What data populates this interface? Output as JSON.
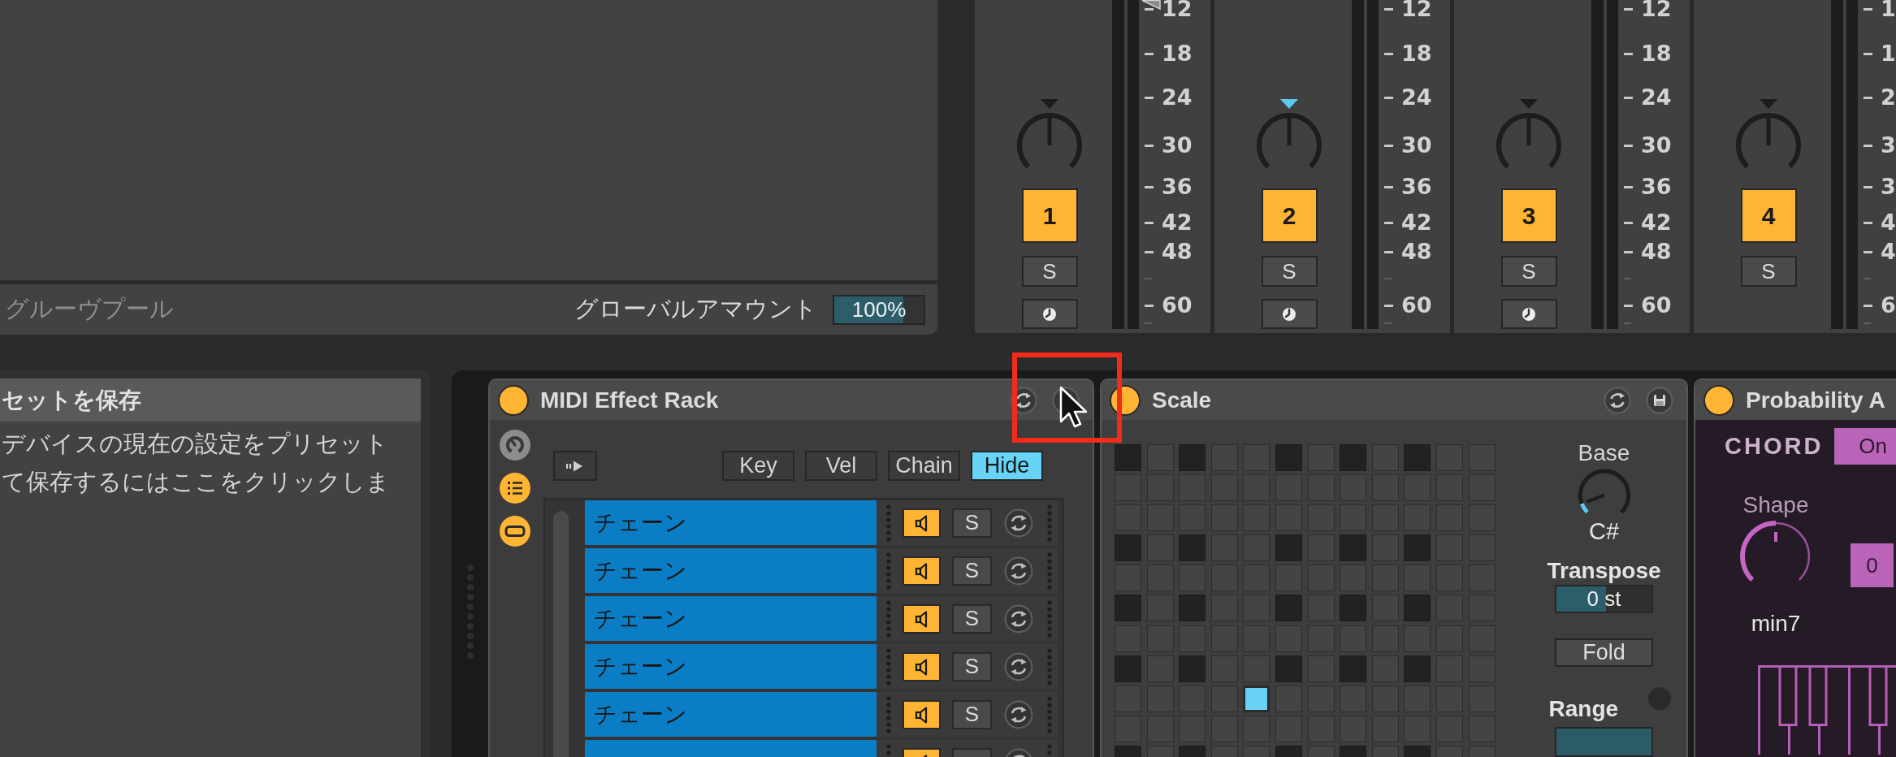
{
  "groove_pool": {
    "title": "グルーヴプール",
    "amount_label": "グローバルアマウント",
    "amount": {
      "value": "100%",
      "level": 0.77
    }
  },
  "mixer": {
    "strips": [
      {
        "number": "1",
        "active": true,
        "volume_marker": true,
        "knob": {
          "level": 0.5,
          "marker_lit": false
        },
        "buttons": [
          {
            "kind": "solo",
            "label": "S"
          },
          {
            "kind": "monitor"
          }
        ],
        "scale": [
          {
            "kind": "label",
            "label": "12"
          },
          {
            "kind": "label",
            "label": "18"
          },
          {
            "kind": "label",
            "label": "24"
          },
          {
            "kind": "label",
            "label": "30"
          },
          {
            "kind": "label",
            "label": "36"
          },
          {
            "kind": "label",
            "label": "42"
          },
          {
            "kind": "label",
            "label": "48"
          },
          {
            "kind": "minor"
          },
          {
            "kind": "label",
            "label": "60"
          },
          {
            "kind": "minor"
          }
        ]
      },
      {
        "number": "2",
        "active": true,
        "volume_marker": false,
        "knob": {
          "level": 0.5,
          "marker_lit": true
        },
        "buttons": [
          {
            "kind": "solo",
            "label": "S"
          },
          {
            "kind": "monitor"
          }
        ],
        "scale": [
          {
            "kind": "label",
            "label": "12"
          },
          {
            "kind": "label",
            "label": "18"
          },
          {
            "kind": "label",
            "label": "24"
          },
          {
            "kind": "label",
            "label": "30"
          },
          {
            "kind": "label",
            "label": "36"
          },
          {
            "kind": "label",
            "label": "42"
          },
          {
            "kind": "label",
            "label": "48"
          },
          {
            "kind": "minor"
          },
          {
            "kind": "label",
            "label": "60"
          },
          {
            "kind": "minor"
          }
        ]
      },
      {
        "number": "3",
        "active": true,
        "volume_marker": false,
        "knob": {
          "level": 0.5,
          "marker_lit": false
        },
        "buttons": [
          {
            "kind": "solo",
            "label": "S"
          },
          {
            "kind": "monitor"
          }
        ],
        "scale": [
          {
            "kind": "label",
            "label": "12"
          },
          {
            "kind": "label",
            "label": "18"
          },
          {
            "kind": "label",
            "label": "24"
          },
          {
            "kind": "label",
            "label": "30"
          },
          {
            "kind": "label",
            "label": "36"
          },
          {
            "kind": "label",
            "label": "42"
          },
          {
            "kind": "label",
            "label": "48"
          },
          {
            "kind": "minor"
          },
          {
            "kind": "label",
            "label": "60"
          },
          {
            "kind": "minor"
          }
        ]
      },
      {
        "number": "4",
        "active": true,
        "volume_marker": false,
        "knob": {
          "level": 0.5,
          "marker_lit": false
        },
        "buttons": [
          {
            "kind": "solo",
            "label": "S"
          }
        ],
        "scale": [
          {
            "kind": "label",
            "label": "1"
          },
          {
            "kind": "label",
            "label": "1"
          },
          {
            "kind": "label",
            "label": "2"
          },
          {
            "kind": "label",
            "label": "3"
          },
          {
            "kind": "label",
            "label": "3"
          },
          {
            "kind": "label",
            "label": "4"
          },
          {
            "kind": "label",
            "label": "4"
          },
          {
            "kind": "minor"
          },
          {
            "kind": "label",
            "label": "6"
          },
          {
            "kind": "minor"
          }
        ]
      }
    ]
  },
  "preset_info": {
    "title": "セットを保存",
    "lines": [
      "デバイスの現在の設定をプリセット",
      "て保存するにはここをクリックしま"
    ]
  },
  "devices": [
    {
      "kind": "rack",
      "title": "MIDI Effect Rack",
      "on": true,
      "header_icons": [
        {
          "kind": "hotswap"
        },
        {
          "kind": "save"
        }
      ],
      "side_toggles": [
        {
          "kind": "macros",
          "on": false
        },
        {
          "kind": "chains",
          "on": true
        },
        {
          "kind": "devices",
          "on": true
        }
      ],
      "view_buttons": [
        {
          "label": "Key",
          "selected": false
        },
        {
          "label": "Vel",
          "selected": false
        },
        {
          "label": "Chain",
          "selected": false
        },
        {
          "label": "Hide",
          "selected": true
        }
      ],
      "chains": [
        {
          "name": "チェーン",
          "active": true,
          "solo_label": "S",
          "soloed": false
        },
        {
          "name": "チェーン",
          "active": true,
          "solo_label": "S",
          "soloed": false
        },
        {
          "name": "チェーン",
          "active": true,
          "solo_label": "S",
          "soloed": false
        },
        {
          "name": "チェーン",
          "active": true,
          "solo_label": "S",
          "soloed": false
        },
        {
          "name": "チェーン",
          "active": true,
          "solo_label": "S",
          "soloed": false
        },
        {
          "active": true,
          "soloed": false
        }
      ]
    },
    {
      "kind": "scale",
      "title": "Scale",
      "on": true,
      "header_icons": [
        {
          "kind": "hotswap"
        },
        {
          "kind": "save"
        }
      ],
      "grid": [
        [
          {
            "shaded": true,
            "selected": false
          },
          {
            "shaded": false,
            "selected": false
          },
          {
            "shaded": true,
            "selected": false
          },
          {
            "shaded": false,
            "selected": false
          },
          {
            "shaded": false,
            "selected": false
          },
          {
            "shaded": true,
            "selected": false
          },
          {
            "shaded": false,
            "selected": false
          },
          {
            "shaded": true,
            "selected": false
          },
          {
            "shaded": false,
            "selected": false
          },
          {
            "shaded": true,
            "selected": false
          },
          {
            "shaded": false,
            "selected": false
          },
          {
            "shaded": false,
            "selected": false
          }
        ],
        [
          {
            "shaded": false,
            "selected": false
          },
          {
            "shaded": false,
            "selected": false
          },
          {
            "shaded": false,
            "selected": false
          },
          {
            "shaded": false,
            "selected": false
          },
          {
            "shaded": false,
            "selected": false
          },
          {
            "shaded": false,
            "selected": false
          },
          {
            "shaded": false,
            "selected": false
          },
          {
            "shaded": false,
            "selected": false
          },
          {
            "shaded": false,
            "selected": false
          },
          {
            "shaded": false,
            "selected": false
          },
          {
            "shaded": false,
            "selected": false
          },
          {
            "shaded": false,
            "selected": false
          }
        ],
        [
          {
            "shaded": false,
            "selected": false
          },
          {
            "shaded": false,
            "selected": false
          },
          {
            "shaded": false,
            "selected": false
          },
          {
            "shaded": false,
            "selected": false
          },
          {
            "shaded": false,
            "selected": false
          },
          {
            "shaded": false,
            "selected": false
          },
          {
            "shaded": false,
            "selected": false
          },
          {
            "shaded": false,
            "selected": false
          },
          {
            "shaded": false,
            "selected": false
          },
          {
            "shaded": false,
            "selected": false
          },
          {
            "shaded": false,
            "selected": false
          },
          {
            "shaded": false,
            "selected": false
          }
        ],
        [
          {
            "shaded": true,
            "selected": false
          },
          {
            "shaded": false,
            "selected": false
          },
          {
            "shaded": true,
            "selected": false
          },
          {
            "shaded": false,
            "selected": false
          },
          {
            "shaded": false,
            "selected": false
          },
          {
            "shaded": true,
            "selected": false
          },
          {
            "shaded": false,
            "selected": false
          },
          {
            "shaded": true,
            "selected": false
          },
          {
            "shaded": false,
            "selected": false
          },
          {
            "shaded": true,
            "selected": false
          },
          {
            "shaded": false,
            "selected": false
          },
          {
            "shaded": false,
            "selected": false
          }
        ],
        [
          {
            "shaded": false,
            "selected": false
          },
          {
            "shaded": false,
            "selected": false
          },
          {
            "shaded": false,
            "selected": false
          },
          {
            "shaded": false,
            "selected": false
          },
          {
            "shaded": false,
            "selected": false
          },
          {
            "shaded": false,
            "selected": false
          },
          {
            "shaded": false,
            "selected": false
          },
          {
            "shaded": false,
            "selected": false
          },
          {
            "shaded": false,
            "selected": false
          },
          {
            "shaded": false,
            "selected": false
          },
          {
            "shaded": false,
            "selected": false
          },
          {
            "shaded": false,
            "selected": false
          }
        ],
        [
          {
            "shaded": true,
            "selected": false
          },
          {
            "shaded": false,
            "selected": false
          },
          {
            "shaded": true,
            "selected": false
          },
          {
            "shaded": false,
            "selected": false
          },
          {
            "shaded": false,
            "selected": false
          },
          {
            "shaded": true,
            "selected": false
          },
          {
            "shaded": false,
            "selected": false
          },
          {
            "shaded": true,
            "selected": false
          },
          {
            "shaded": false,
            "selected": false
          },
          {
            "shaded": true,
            "selected": false
          },
          {
            "shaded": false,
            "selected": false
          },
          {
            "shaded": false,
            "selected": false
          }
        ],
        [
          {
            "shaded": false,
            "selected": false
          },
          {
            "shaded": false,
            "selected": false
          },
          {
            "shaded": false,
            "selected": false
          },
          {
            "shaded": false,
            "selected": false
          },
          {
            "shaded": false,
            "selected": false
          },
          {
            "shaded": false,
            "selected": false
          },
          {
            "shaded": false,
            "selected": false
          },
          {
            "shaded": false,
            "selected": false
          },
          {
            "shaded": false,
            "selected": false
          },
          {
            "shaded": false,
            "selected": false
          },
          {
            "shaded": false,
            "selected": false
          },
          {
            "shaded": false,
            "selected": false
          }
        ],
        [
          {
            "shaded": true,
            "selected": false
          },
          {
            "shaded": false,
            "selected": false
          },
          {
            "shaded": true,
            "selected": false
          },
          {
            "shaded": false,
            "selected": false
          },
          {
            "shaded": false,
            "selected": false
          },
          {
            "shaded": true,
            "selected": false
          },
          {
            "shaded": false,
            "selected": false
          },
          {
            "shaded": true,
            "selected": false
          },
          {
            "shaded": false,
            "selected": false
          },
          {
            "shaded": true,
            "selected": false
          },
          {
            "shaded": false,
            "selected": false
          },
          {
            "shaded": false,
            "selected": false
          }
        ],
        [
          {
            "shaded": false,
            "selected": false
          },
          {
            "shaded": false,
            "selected": false
          },
          {
            "shaded": false,
            "selected": false
          },
          {
            "shaded": false,
            "selected": false
          },
          {
            "shaded": false,
            "selected": true
          },
          {
            "shaded": false,
            "selected": false
          },
          {
            "shaded": false,
            "selected": false
          },
          {
            "shaded": false,
            "selected": false
          },
          {
            "shaded": false,
            "selected": false
          },
          {
            "shaded": false,
            "selected": false
          },
          {
            "shaded": false,
            "selected": false
          },
          {
            "shaded": false,
            "selected": false
          }
        ],
        [
          {
            "shaded": false,
            "selected": false
          },
          {
            "shaded": false,
            "selected": false
          },
          {
            "shaded": false,
            "selected": false
          },
          {
            "shaded": false,
            "selected": false
          },
          {
            "shaded": false,
            "selected": false
          },
          {
            "shaded": false,
            "selected": false
          },
          {
            "shaded": false,
            "selected": false
          },
          {
            "shaded": false,
            "selected": false
          },
          {
            "shaded": false,
            "selected": false
          },
          {
            "shaded": false,
            "selected": false
          },
          {
            "shaded": false,
            "selected": false
          },
          {
            "shaded": false,
            "selected": false
          }
        ],
        [
          {
            "shaded": true,
            "selected": false
          },
          {
            "shaded": false,
            "selected": false
          },
          {
            "shaded": true,
            "selected": false
          },
          {
            "shaded": false,
            "selected": false
          },
          {
            "shaded": false,
            "selected": false
          },
          {
            "shaded": true,
            "selected": false
          },
          {
            "shaded": false,
            "selected": false
          },
          {
            "shaded": true,
            "selected": false
          },
          {
            "shaded": false,
            "selected": false
          },
          {
            "shaded": true,
            "selected": false
          },
          {
            "shaded": false,
            "selected": false
          },
          {
            "shaded": false,
            "selected": false
          }
        ]
      ],
      "base": {
        "label": "Base",
        "value": "C#",
        "level": 0.09
      },
      "transpose": {
        "label": "Transpose",
        "value": "0 st",
        "level": 0.52
      },
      "fold": {
        "label": "Fold",
        "on": false
      },
      "range": {
        "label": "Range",
        "toggle_on": false
      }
    },
    {
      "kind": "chord",
      "title": "Probability A",
      "on": true,
      "chord": {
        "label": "CHORD",
        "toggle": {
          "label": "On",
          "on": true
        }
      },
      "shape": {
        "label": "Shape",
        "value": "min7",
        "level": 0.5
      },
      "offset_button": {
        "label": "0"
      }
    }
  ]
}
